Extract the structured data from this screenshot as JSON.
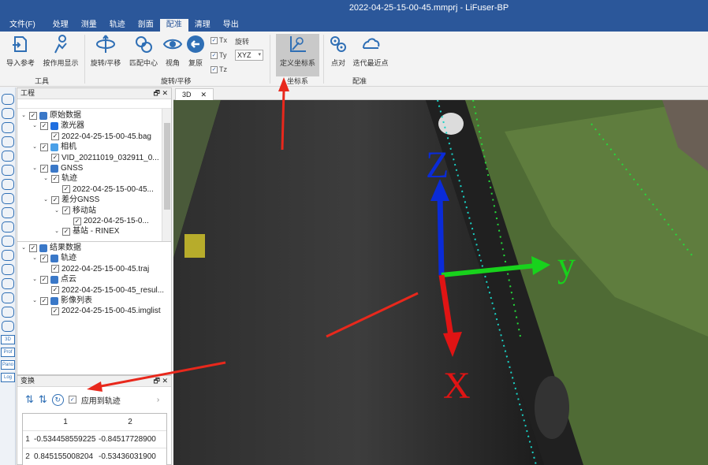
{
  "window": {
    "title": "2022-04-25-15-00-45.mmprj - LiFuser-BP"
  },
  "menus": [
    "文件(F)",
    "处理",
    "测量",
    "轨迹",
    "剖面",
    "配准",
    "清理",
    "导出"
  ],
  "active_menu_index": 5,
  "ribbon": {
    "import_ref": "导入参考",
    "by_traj": "按作用显示",
    "group_tools": "工具",
    "rotate_pan": "旋转/平移",
    "match_center": "匹配中心",
    "view": "视角",
    "restore": "复原",
    "tx": "Tx",
    "ty": "Ty",
    "tz": "Tz",
    "rotate_label": "旋转",
    "rotate_order": "XYZ",
    "group_rotate": "旋转/平移",
    "define_coord": "定义坐标系",
    "group_coord": "坐标系",
    "point_pair": "点对",
    "icp": "迭代最近点",
    "group_register": "配准"
  },
  "project_panel": {
    "title": "工程",
    "tree": [
      {
        "label": "原始数据",
        "indent": 0,
        "exp": "v",
        "icon": "layers-icon",
        "color": "#3a78c8"
      },
      {
        "label": "激光器",
        "indent": 1,
        "exp": "v",
        "icon": "laser-icon",
        "color": "#1f6fe0"
      },
      {
        "label": "2022-04-25-15-00-45.bag",
        "indent": 2,
        "exp": "",
        "icon": "",
        "color": ""
      },
      {
        "label": "相机",
        "indent": 1,
        "exp": "v",
        "icon": "camera-icon",
        "color": "#4aa0e8"
      },
      {
        "label": "VID_20211019_032911_0...",
        "indent": 2,
        "exp": "",
        "icon": "",
        "color": ""
      },
      {
        "label": "GNSS",
        "indent": 1,
        "exp": "v",
        "icon": "gnss-icon",
        "color": "#3a78c8"
      },
      {
        "label": "轨迹",
        "indent": 2,
        "exp": "v",
        "icon": "",
        "color": ""
      },
      {
        "label": "2022-04-25-15-00-45...",
        "indent": 3,
        "exp": "",
        "icon": "",
        "color": ""
      },
      {
        "label": "差分GNSS",
        "indent": 2,
        "exp": "v",
        "icon": "",
        "color": ""
      },
      {
        "label": "移动站",
        "indent": 3,
        "exp": "v",
        "icon": "",
        "color": ""
      },
      {
        "label": "2022-04-25-15-0...",
        "indent": 4,
        "exp": "",
        "icon": "",
        "color": ""
      },
      {
        "label": "基站 - RINEX",
        "indent": 3,
        "exp": "v",
        "icon": "",
        "color": ""
      }
    ],
    "results": [
      {
        "label": "结果数据",
        "indent": 0,
        "exp": "v",
        "icon": "layers-icon",
        "color": "#3a78c8"
      },
      {
        "label": "轨迹",
        "indent": 1,
        "exp": "v",
        "icon": "pin-icon",
        "color": "#3a78c8"
      },
      {
        "label": "2022-04-25-15-00-45.traj",
        "indent": 2,
        "exp": "",
        "icon": "",
        "color": ""
      },
      {
        "label": "点云",
        "indent": 1,
        "exp": "v",
        "icon": "cloud-icon",
        "color": "#3a78c8"
      },
      {
        "label": "2022-04-25-15-00-45_resul...",
        "indent": 2,
        "exp": "",
        "icon": "",
        "color": ""
      },
      {
        "label": "影像列表",
        "indent": 1,
        "exp": "v",
        "icon": "image-icon",
        "color": "#3a78c8"
      },
      {
        "label": "2022-04-25-15-00-45.imglist",
        "indent": 2,
        "exp": "",
        "icon": "",
        "color": ""
      }
    ]
  },
  "transform_panel": {
    "title": "变换",
    "apply_to_traj": "应用到轨迹",
    "col_headers": [
      "1",
      "2"
    ],
    "rows": [
      {
        "index": "1",
        "c1": "-0.534458559225",
        "c2": "-0.84517728900"
      },
      {
        "index": "2",
        "c1": "0.845155008204",
        "c2": "-0.53436031900"
      }
    ]
  },
  "left_toolbar_labels": [
    "3D",
    "Prof",
    "Pano",
    "Log"
  ],
  "viewport": {
    "tab": "3D",
    "axis_z": "Z",
    "axis_y": "y",
    "axis_x": "X"
  },
  "colors": {
    "title_bar": "#2b579a",
    "axis_z": "#0a2bd8",
    "axis_y": "#18d21c",
    "axis_x": "#e01414",
    "annotation_arrow": "#e8281c"
  }
}
